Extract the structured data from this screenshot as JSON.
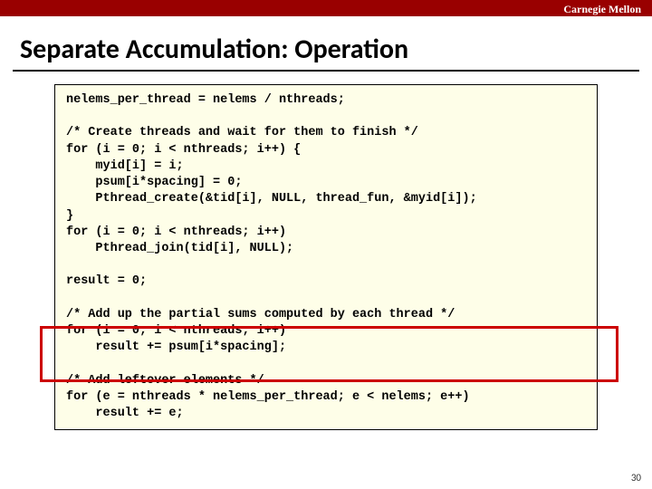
{
  "header": {
    "brand": "Carnegie Mellon"
  },
  "title": "Separate Accumulation: Operation",
  "code": {
    "l1": "nelems_per_thread = nelems / nthreads;",
    "l2": "",
    "l3": "/* Create threads and wait for them to finish */",
    "l4": "for (i = 0; i < nthreads; i++) {",
    "l5": "    myid[i] = i;",
    "l6": "    psum[i*spacing] = 0;",
    "l7": "    Pthread_create(&tid[i], NULL, thread_fun, &myid[i]);",
    "l8": "}",
    "l9": "for (i = 0; i < nthreads; i++)",
    "l10": "    Pthread_join(tid[i], NULL);",
    "l11": "",
    "l12": "result = 0;",
    "l13": "",
    "l14": "/* Add up the partial sums computed by each thread */",
    "l15": "for (i = 0; i < nthreads; i++)",
    "l16": "    result += psum[i*spacing];",
    "l17": "",
    "l18": "/* Add leftover elements */",
    "l19": "for (e = nthreads * nelems_per_thread; e < nelems; e++)",
    "l20": "    result += e;"
  },
  "page_number": "30"
}
